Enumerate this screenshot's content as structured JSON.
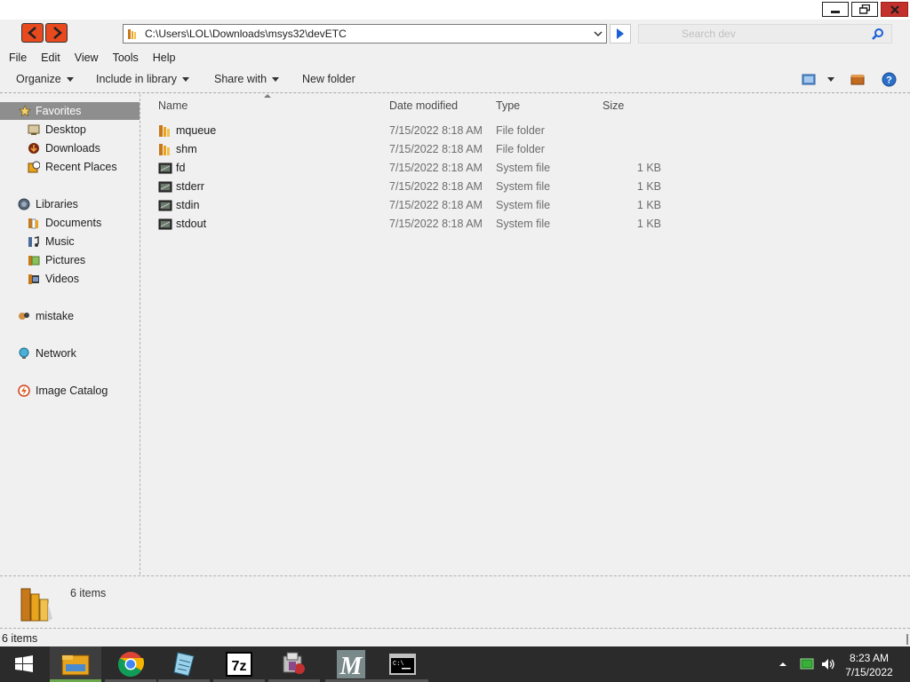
{
  "window": {
    "address_path": "C:\\Users\\LOL\\Downloads\\msys32\\devETC",
    "search_placeholder": "Search dev"
  },
  "menu": [
    "File",
    "Edit",
    "View",
    "Tools",
    "Help"
  ],
  "commands": {
    "organize": "Organize",
    "include_in_library": "Include in library",
    "share_with": "Share with",
    "new_folder": "New folder"
  },
  "nav": {
    "favorites": "Favorites",
    "desktop": "Desktop",
    "downloads": "Downloads",
    "recent_places": "Recent Places",
    "libraries": "Libraries",
    "documents": "Documents",
    "music": "Music",
    "pictures": "Pictures",
    "videos": "Videos",
    "mistake": "mistake",
    "network": "Network",
    "image_catalog": "Image Catalog"
  },
  "columns": {
    "name": "Name",
    "date_modified": "Date modified",
    "type": "Type",
    "size": "Size"
  },
  "files": [
    {
      "name": "mqueue",
      "date": "7/15/2022 8:18 AM",
      "type": "File folder",
      "size": "",
      "icon": "folder-icon"
    },
    {
      "name": "shm",
      "date": "7/15/2022 8:18 AM",
      "type": "File folder",
      "size": "",
      "icon": "folder-icon"
    },
    {
      "name": "fd",
      "date": "7/15/2022 8:18 AM",
      "type": "System file",
      "size": "1 KB",
      "icon": "system-file-icon"
    },
    {
      "name": "stderr",
      "date": "7/15/2022 8:18 AM",
      "type": "System file",
      "size": "1 KB",
      "icon": "system-file-icon"
    },
    {
      "name": "stdin",
      "date": "7/15/2022 8:18 AM",
      "type": "System file",
      "size": "1 KB",
      "icon": "system-file-icon"
    },
    {
      "name": "stdout",
      "date": "7/15/2022 8:18 AM",
      "type": "System file",
      "size": "1 KB",
      "icon": "system-file-icon"
    }
  ],
  "details": {
    "count": "6 items"
  },
  "status": {
    "text": "6 items"
  },
  "taskbar": {
    "apps": [
      "start-icon",
      "file-explorer-icon",
      "chrome-icon",
      "notepad-icon",
      "7zip-icon",
      "installer-icon",
      "msys-icon",
      "terminal-icon"
    ],
    "time": "8:23 AM",
    "date": "7/15/2022"
  },
  "colors": {
    "nav_selected": "#8e8e8e",
    "close_button": "#c4302b",
    "taskbar": "#2b2b2b",
    "nav_arrows": "#e8491d",
    "folder": "#e8a41c"
  }
}
